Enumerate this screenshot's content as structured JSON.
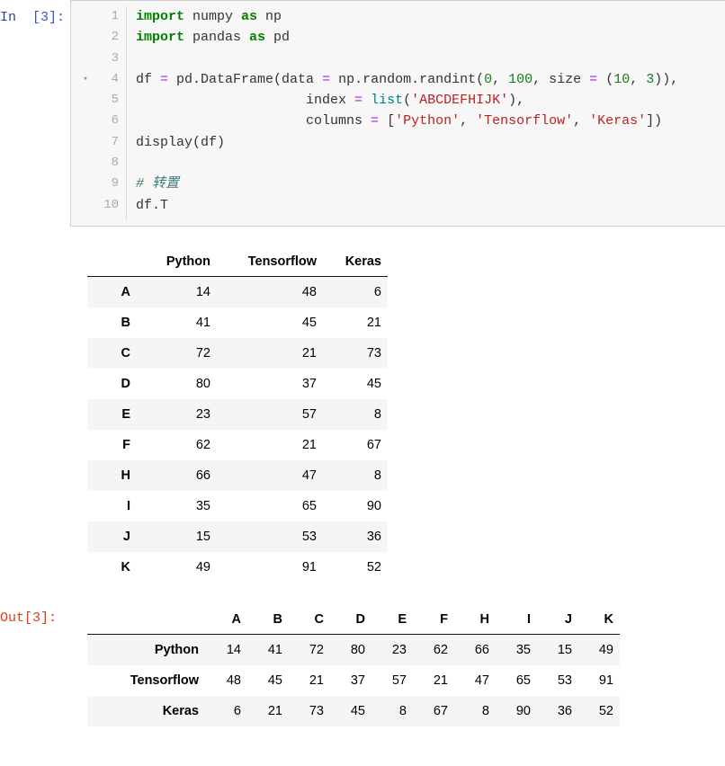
{
  "input_cell": {
    "prompt_label": "In",
    "prompt_number": "[3]:",
    "line_numbers": [
      "1",
      "2",
      "3",
      "4",
      "5",
      "6",
      "7",
      "8",
      "9",
      "10"
    ],
    "fold_arrow_icon": "▾",
    "fold_arrow_line": 4,
    "code_lines": [
      [
        {
          "t": "import",
          "c": "kw"
        },
        {
          "t": " numpy ",
          "c": "name"
        },
        {
          "t": "as",
          "c": "kw"
        },
        {
          "t": " np",
          "c": "name"
        }
      ],
      [
        {
          "t": "import",
          "c": "kw"
        },
        {
          "t": " pandas ",
          "c": "name"
        },
        {
          "t": "as",
          "c": "kw"
        },
        {
          "t": " pd",
          "c": "name"
        }
      ],
      [],
      [
        {
          "t": "df ",
          "c": "name"
        },
        {
          "t": "=",
          "c": "op"
        },
        {
          "t": " pd.DataFrame(data ",
          "c": "name"
        },
        {
          "t": "=",
          "c": "op"
        },
        {
          "t": " np.random.randint(",
          "c": "name"
        },
        {
          "t": "0",
          "c": "num"
        },
        {
          "t": ", ",
          "c": "punct"
        },
        {
          "t": "100",
          "c": "num"
        },
        {
          "t": ", size ",
          "c": "name"
        },
        {
          "t": "=",
          "c": "op"
        },
        {
          "t": " (",
          "c": "punct"
        },
        {
          "t": "10",
          "c": "num"
        },
        {
          "t": ", ",
          "c": "punct"
        },
        {
          "t": "3",
          "c": "num"
        },
        {
          "t": ")),",
          "c": "punct"
        }
      ],
      [
        {
          "t": "                     index ",
          "c": "name"
        },
        {
          "t": "=",
          "c": "op"
        },
        {
          "t": " ",
          "c": "punct"
        },
        {
          "t": "list",
          "c": "builtin"
        },
        {
          "t": "(",
          "c": "punct"
        },
        {
          "t": "'ABCDEFHIJK'",
          "c": "str"
        },
        {
          "t": "),",
          "c": "punct"
        }
      ],
      [
        {
          "t": "                     columns ",
          "c": "name"
        },
        {
          "t": "=",
          "c": "op"
        },
        {
          "t": " [",
          "c": "punct"
        },
        {
          "t": "'Python'",
          "c": "str"
        },
        {
          "t": ", ",
          "c": "punct"
        },
        {
          "t": "'Tensorflow'",
          "c": "str"
        },
        {
          "t": ", ",
          "c": "punct"
        },
        {
          "t": "'Keras'",
          "c": "str"
        },
        {
          "t": "])",
          "c": "punct"
        }
      ],
      [
        {
          "t": "display(df)",
          "c": "name"
        }
      ],
      [],
      [
        {
          "t": "# 转置",
          "c": "comment"
        }
      ],
      [
        {
          "t": "df.T",
          "c": "name"
        }
      ]
    ]
  },
  "dataframe_display": {
    "columns": [
      "Python",
      "Tensorflow",
      "Keras"
    ],
    "index": [
      "A",
      "B",
      "C",
      "D",
      "E",
      "F",
      "H",
      "I",
      "J",
      "K"
    ],
    "rows": [
      [
        "14",
        "48",
        "6"
      ],
      [
        "41",
        "45",
        "21"
      ],
      [
        "72",
        "21",
        "73"
      ],
      [
        "80",
        "37",
        "45"
      ],
      [
        "23",
        "57",
        "8"
      ],
      [
        "62",
        "21",
        "67"
      ],
      [
        "66",
        "47",
        "8"
      ],
      [
        "35",
        "65",
        "90"
      ],
      [
        "15",
        "53",
        "36"
      ],
      [
        "49",
        "91",
        "52"
      ]
    ]
  },
  "output_cell": {
    "prompt_label": "Out[3]:",
    "dataframe_transposed": {
      "columns": [
        "A",
        "B",
        "C",
        "D",
        "E",
        "F",
        "H",
        "I",
        "J",
        "K"
      ],
      "index": [
        "Python",
        "Tensorflow",
        "Keras"
      ],
      "rows": [
        [
          "14",
          "41",
          "72",
          "80",
          "23",
          "62",
          "66",
          "35",
          "15",
          "49"
        ],
        [
          "48",
          "45",
          "21",
          "37",
          "57",
          "21",
          "47",
          "65",
          "53",
          "91"
        ],
        [
          "6",
          "21",
          "73",
          "45",
          "8",
          "67",
          "8",
          "90",
          "36",
          "52"
        ]
      ]
    }
  },
  "colors": {
    "keyword": "#008000",
    "string": "#ba2121",
    "number": "#1c7a1c",
    "operator": "#aa22ff",
    "builtin": "#008080",
    "comment": "#3d7b7b",
    "in_prompt": "#303f9f",
    "out_prompt": "#d84315",
    "cell_background": "#f7f7f7",
    "row_stripe": "#f5f5f5"
  }
}
